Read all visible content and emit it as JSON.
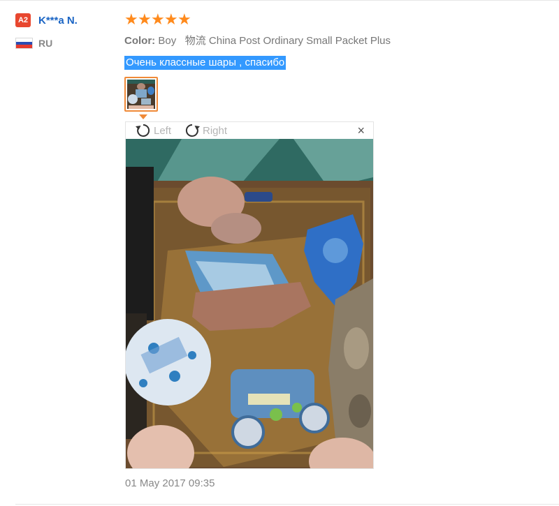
{
  "user": {
    "badge": "A2",
    "name": "K***a N.",
    "country": "RU",
    "flag_colors": [
      "#ffffff",
      "#2a4cb3",
      "#e63a2e"
    ]
  },
  "review": {
    "rating": 5,
    "stars": [
      "★",
      "★",
      "★",
      "★",
      "★"
    ],
    "color_label": "Color:",
    "color_value": "Boy",
    "logistics_label": "物流",
    "logistics_value": "China Post Ordinary Small Packet Plus",
    "text": "Очень классные шары , спасибо",
    "date": "01 May 2017 09:35"
  },
  "viewer": {
    "rotate_left_label": "Left",
    "rotate_right_label": "Right",
    "close_label": "×"
  },
  "colors": {
    "accent_orange": "#ff8a1c",
    "link_blue": "#1a64c4",
    "selection_blue": "#3399ff"
  }
}
